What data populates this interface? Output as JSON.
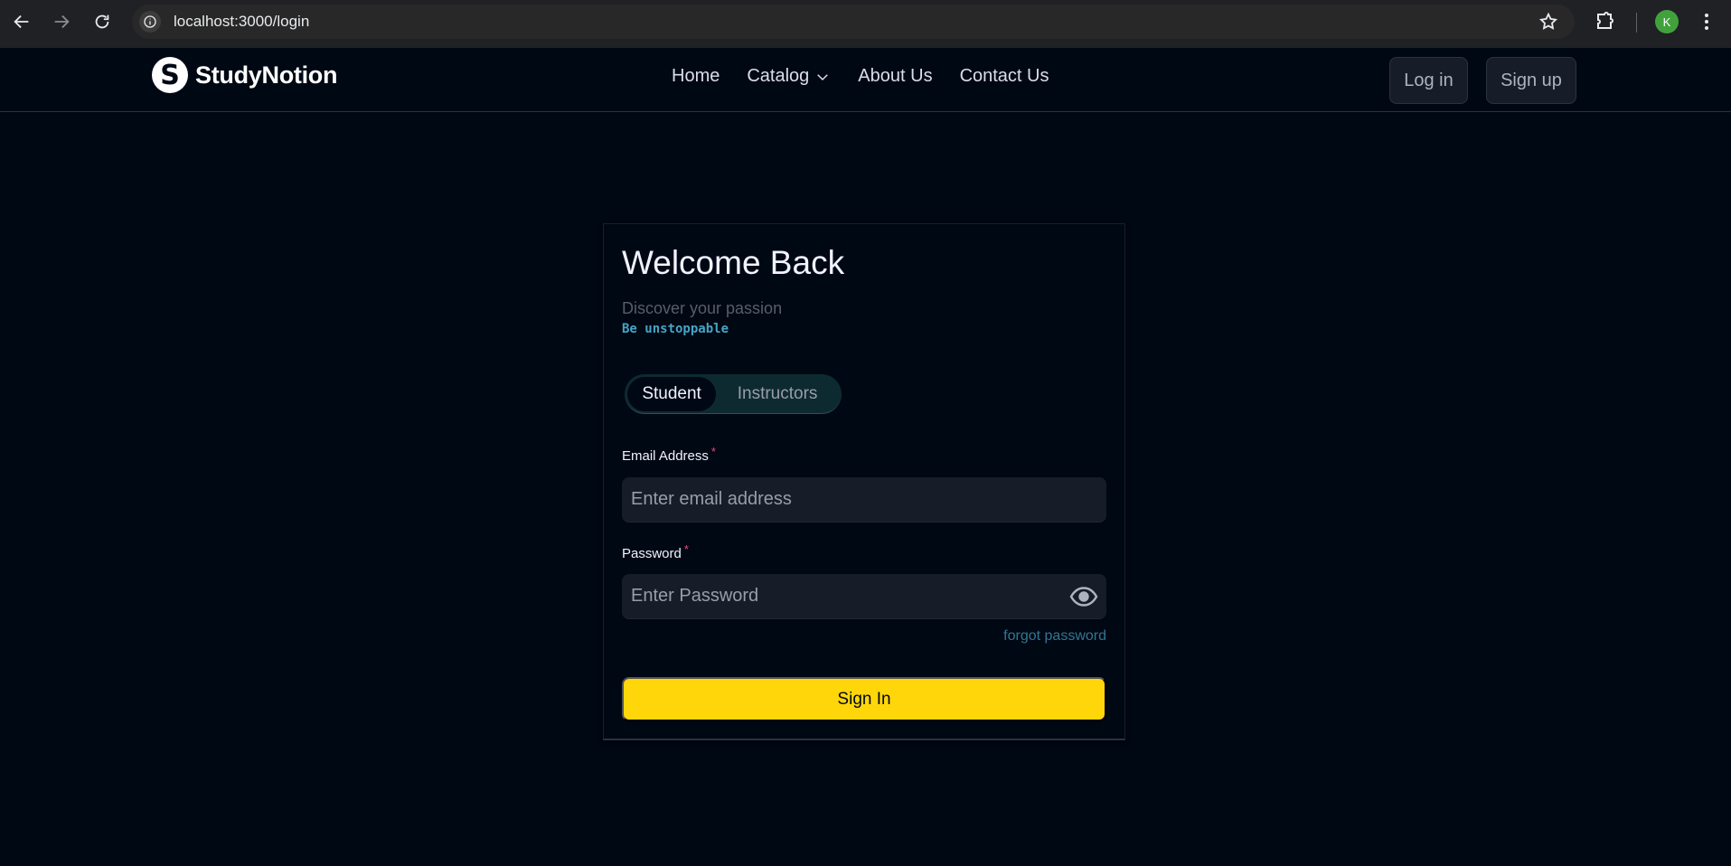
{
  "browser": {
    "url": "localhost:3000/login",
    "profile_initial": "K"
  },
  "header": {
    "logo_mark": "S",
    "logo_text": "StudyNotion",
    "nav": [
      {
        "label": "Home"
      },
      {
        "label": "Catalog"
      },
      {
        "label": "About Us"
      },
      {
        "label": "Contact Us"
      }
    ],
    "login_label": "Log in",
    "signup_label": "Sign up"
  },
  "login": {
    "title": "Welcome Back",
    "subtitle": "Discover your passion",
    "tagline": "Be unstoppable",
    "roles": [
      "Student",
      "Instructors"
    ],
    "active_role": "Student",
    "email_label": "Email Address",
    "email_placeholder": "Enter email address",
    "password_label": "Password",
    "password_placeholder": "Enter Password",
    "required_marker": "*",
    "forgot_label": "forgot password",
    "submit_label": "Sign In"
  },
  "colors": {
    "background": "#000814",
    "accent": "#ffd60a",
    "link": "#47a5c5",
    "required": "#ef476f"
  }
}
